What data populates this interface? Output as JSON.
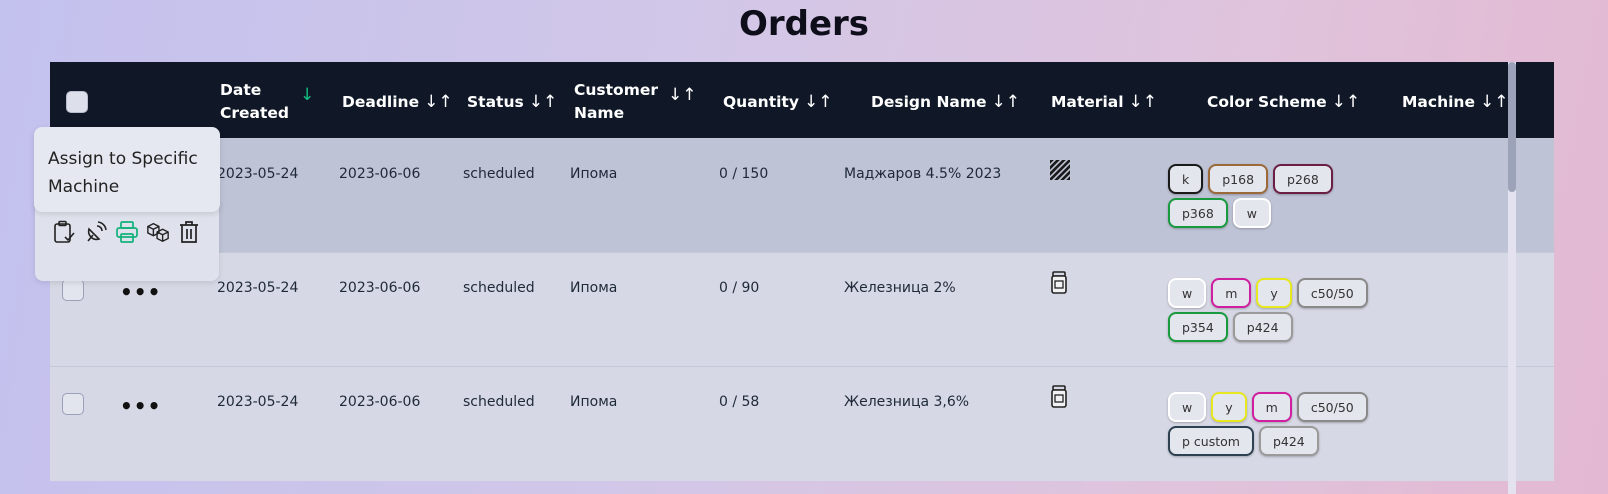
{
  "page": {
    "title": "Orders"
  },
  "columns": [
    {
      "label": "Date Created",
      "arrows": "↓",
      "active": true
    },
    {
      "label": "Deadline",
      "arrows": "↓↑"
    },
    {
      "label": "Status",
      "arrows": "↓↑"
    },
    {
      "label": "Customer Name",
      "arrows": "↓↑"
    },
    {
      "label": "Quantity",
      "arrows": "↓↑"
    },
    {
      "label": "Design Name",
      "arrows": "↓↑"
    },
    {
      "label": "Material",
      "arrows": "↓↑"
    },
    {
      "label": "Color Scheme",
      "arrows": "↓↑"
    },
    {
      "label": "Machine",
      "arrows": "↓↑"
    }
  ],
  "tooltip": {
    "text": "Assign to Specific Machine"
  },
  "row_actions": [
    {
      "icon": "clipboard-check-icon",
      "color": "#222222"
    },
    {
      "icon": "satellite-dish-icon",
      "color": "#222222"
    },
    {
      "icon": "printer-icon",
      "color": "#10b27a"
    },
    {
      "icon": "boxes-icon",
      "color": "#222222"
    },
    {
      "icon": "trash-icon",
      "color": "#222222"
    }
  ],
  "rows": [
    {
      "date_created": "2023-05-24",
      "deadline": "2023-06-06",
      "status": "scheduled",
      "customer": "Ипома",
      "quantity": "0 / 150",
      "design": "Маджаров 4.5% 2023",
      "material_icon": "striped-material-icon",
      "colors": [
        {
          "label": "k",
          "color": "#1a1a1a"
        },
        {
          "label": "p168",
          "color": "#9c6a3a"
        },
        {
          "label": "p268",
          "color": "#6b1f45"
        },
        {
          "label": "p368",
          "color": "#1a9a3e"
        },
        {
          "label": "w",
          "color": "#ffffff"
        }
      ],
      "machine": ""
    },
    {
      "date_created": "2023-05-24",
      "deadline": "2023-06-06",
      "status": "scheduled",
      "customer": "Ипома",
      "quantity": "0 / 90",
      "design": "Железница 2%",
      "material_icon": "jar-icon",
      "colors": [
        {
          "label": "w",
          "color": "#ffffff"
        },
        {
          "label": "m",
          "color": "#d01ea0"
        },
        {
          "label": "y",
          "color": "#e8e820"
        },
        {
          "label": "c50/50",
          "color": "#8a8a8a"
        },
        {
          "label": "p354",
          "color": "#1a9a3e"
        },
        {
          "label": "p424",
          "color": "#9a9a9a"
        }
      ],
      "machine": ""
    },
    {
      "date_created": "2023-05-24",
      "deadline": "2023-06-06",
      "status": "scheduled",
      "customer": "Ипома",
      "quantity": "0 / 58",
      "design": "Железница 3,6%",
      "material_icon": "jar-icon",
      "colors": [
        {
          "label": "w",
          "color": "#ffffff"
        },
        {
          "label": "y",
          "color": "#e8e820"
        },
        {
          "label": "m",
          "color": "#d01ea0"
        },
        {
          "label": "c50/50",
          "color": "#8a8a8a"
        },
        {
          "label": "p custom",
          "color": "#2d4150"
        },
        {
          "label": "p424",
          "color": "#9a9a9a"
        }
      ],
      "machine": ""
    }
  ],
  "colors": {
    "header_bg": "#101828",
    "active_sort": "#10c080",
    "row_highlight": "#bec3d6",
    "row_bg": "#d6d9e5"
  }
}
